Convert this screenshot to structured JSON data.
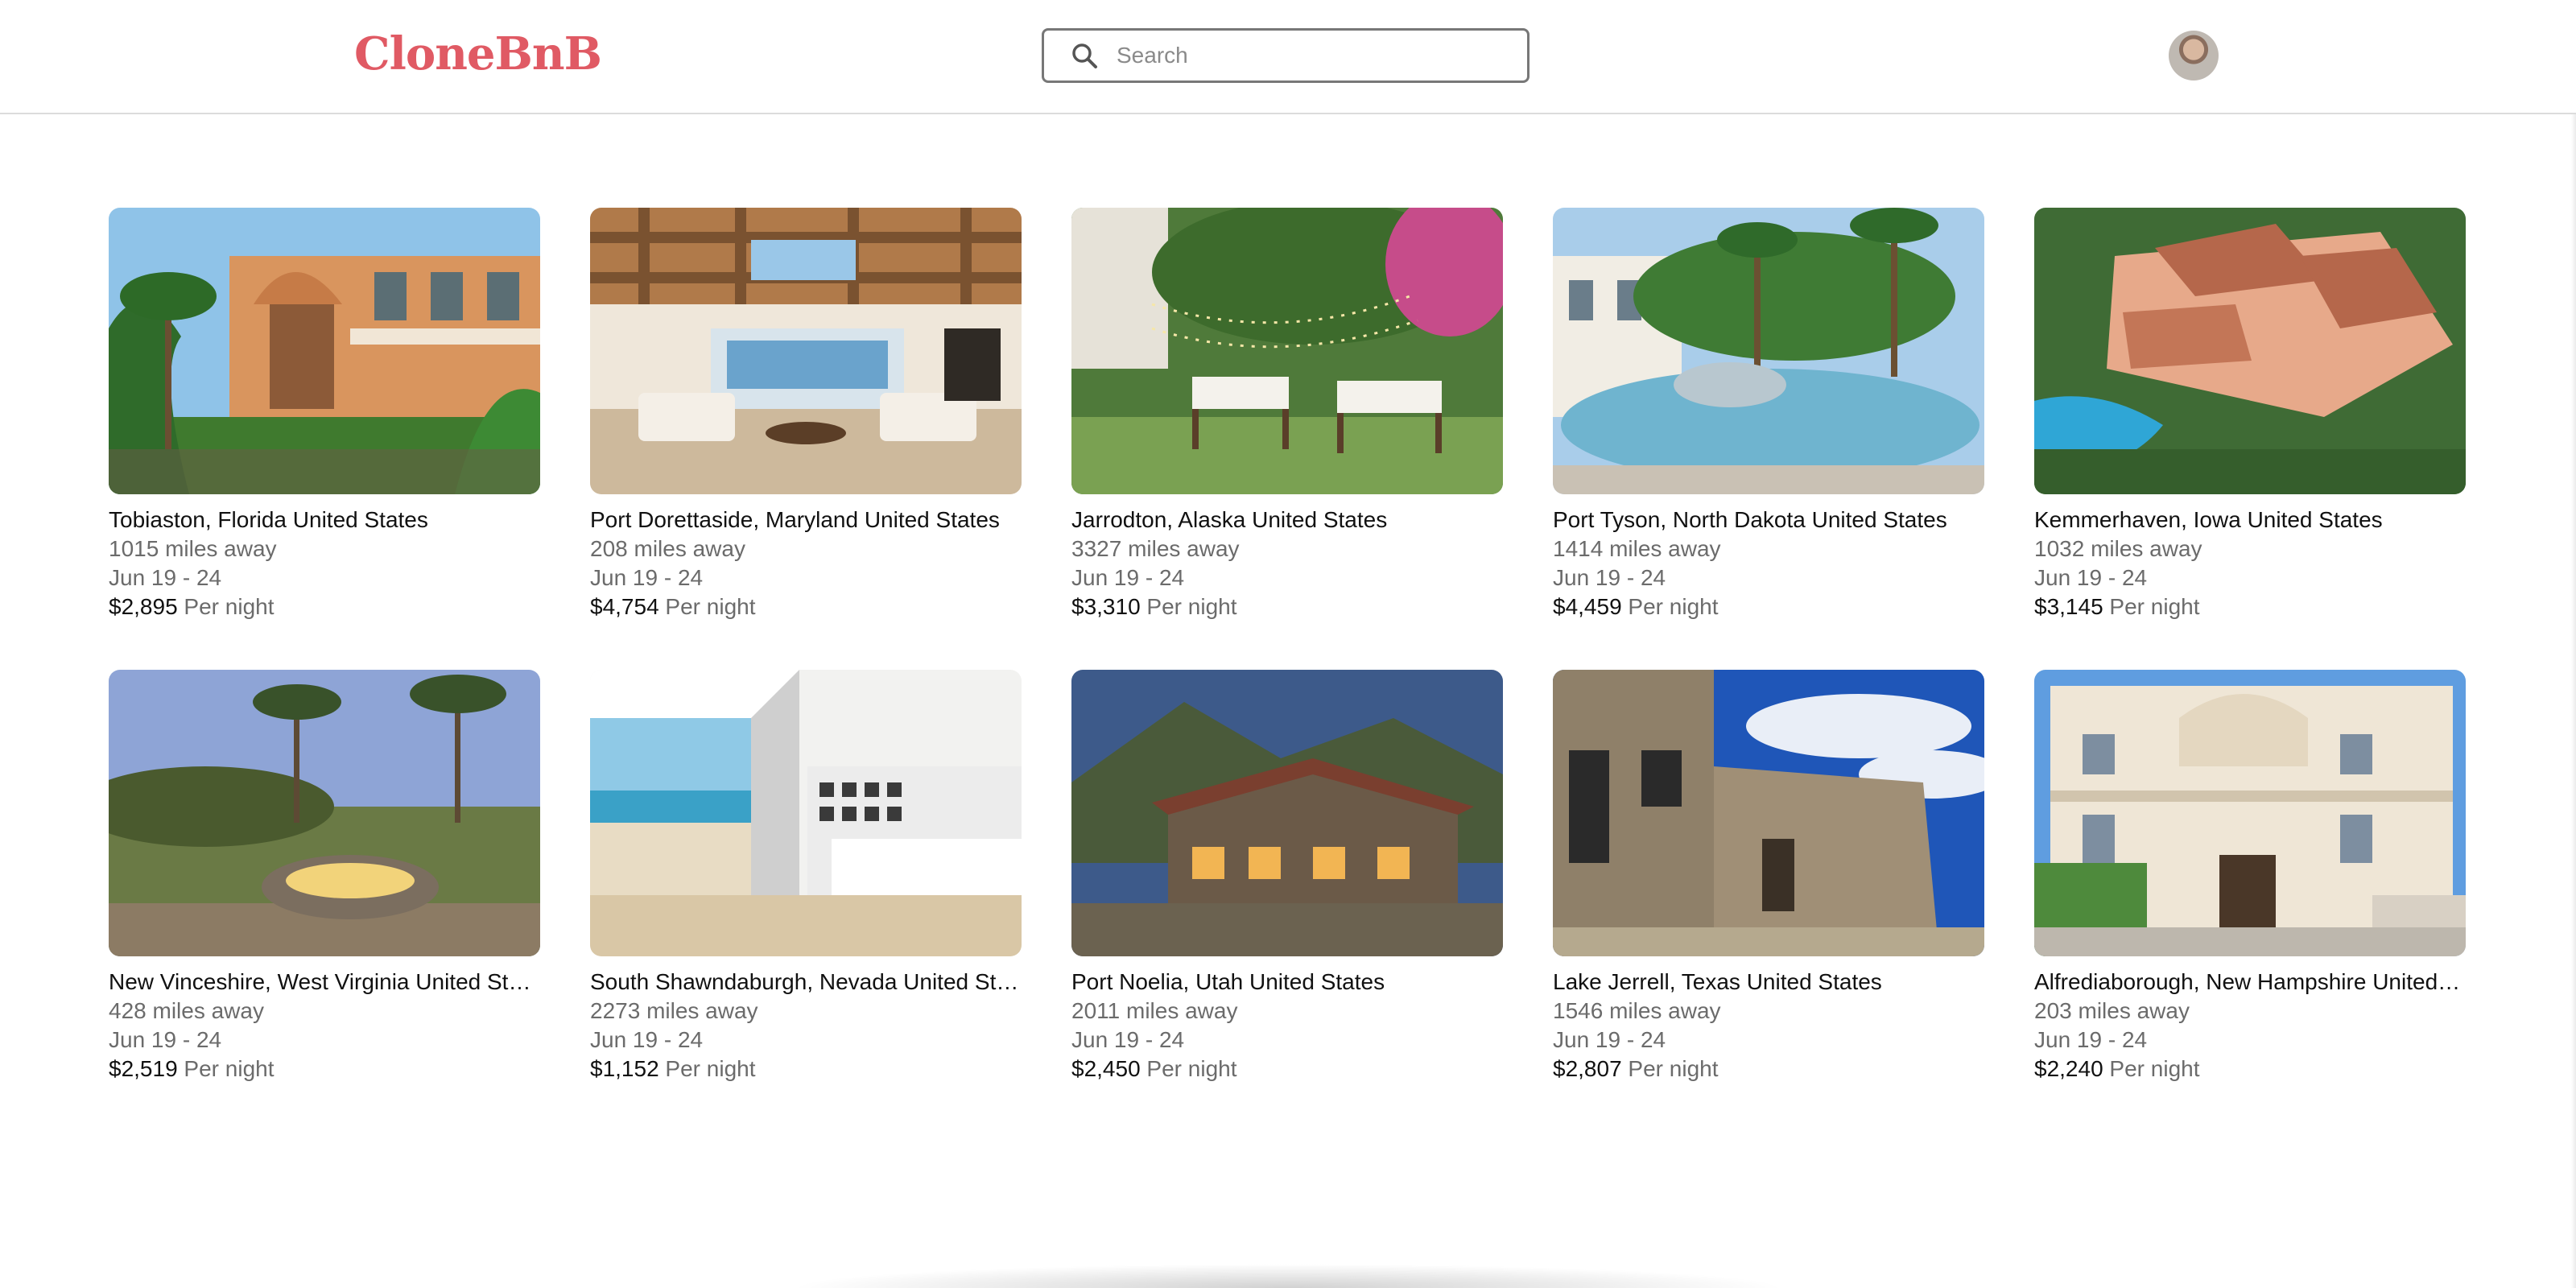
{
  "header": {
    "logo_text": "CloneBnB",
    "search": {
      "placeholder": "Search",
      "value": ""
    },
    "avatar_icon": "user-avatar"
  },
  "colors": {
    "brand": "#e05a64",
    "text": "#111111",
    "muted": "#6b6b6b",
    "border": "#777777"
  },
  "listings": [
    {
      "location": "Tobiaston, Florida United States",
      "distance": "1015 miles away",
      "dates": "Jun 19 - 24",
      "price": "$2,895",
      "per_night": "Per night"
    },
    {
      "location": "Port Dorettaside, Maryland United States",
      "distance": "208 miles away",
      "dates": "Jun 19 - 24",
      "price": "$4,754",
      "per_night": "Per night"
    },
    {
      "location": "Jarrodton, Alaska United States",
      "distance": "3327 miles away",
      "dates": "Jun 19 - 24",
      "price": "$3,310",
      "per_night": "Per night"
    },
    {
      "location": "Port Tyson, North Dakota United States",
      "distance": "1414 miles away",
      "dates": "Jun 19 - 24",
      "price": "$4,459",
      "per_night": "Per night"
    },
    {
      "location": "Kemmerhaven, Iowa United States",
      "distance": "1032 miles away",
      "dates": "Jun 19 - 24",
      "price": "$3,145",
      "per_night": "Per night"
    },
    {
      "location": "New Vinceshire, West Virginia United States",
      "distance": "428 miles away",
      "dates": "Jun 19 - 24",
      "price": "$2,519",
      "per_night": "Per night"
    },
    {
      "location": "South Shawndaburgh, Nevada United States",
      "distance": "2273 miles away",
      "dates": "Jun 19 - 24",
      "price": "$1,152",
      "per_night": "Per night"
    },
    {
      "location": "Port Noelia, Utah United States",
      "distance": "2011 miles away",
      "dates": "Jun 19 - 24",
      "price": "$2,450",
      "per_night": "Per night"
    },
    {
      "location": "Lake Jerrell, Texas United States",
      "distance": "1546 miles away",
      "dates": "Jun 19 - 24",
      "price": "$2,807",
      "per_night": "Per night"
    },
    {
      "location": "Alfrediaborough, New Hampshire United States",
      "distance": "203 miles away",
      "dates": "Jun 19 - 24",
      "price": "$2,240",
      "per_night": "Per night"
    }
  ]
}
